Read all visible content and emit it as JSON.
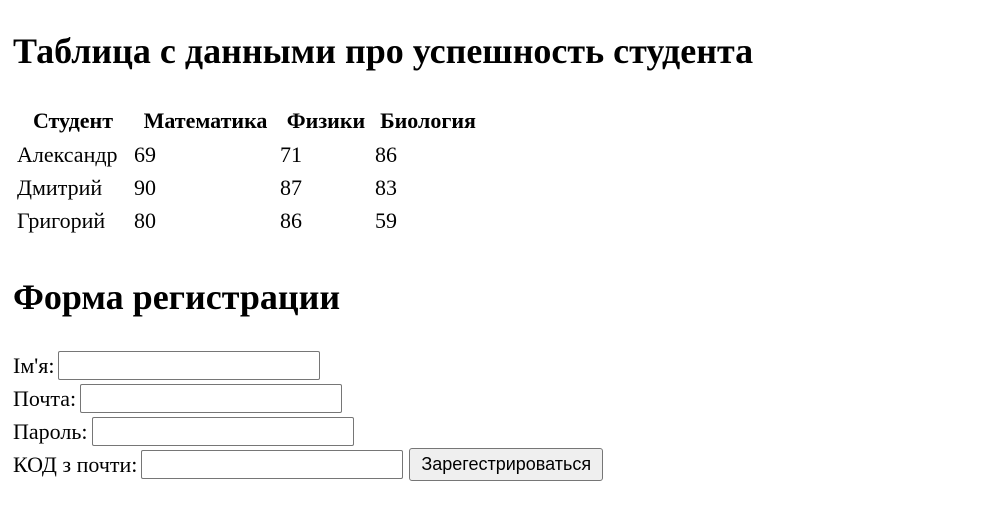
{
  "table_section": {
    "title": "Таблица с данными про успешность студента",
    "headers": [
      "Студент",
      "Математика",
      "Физики",
      "Биология"
    ],
    "rows": [
      [
        "Александр",
        "69",
        "71",
        "86"
      ],
      [
        "Дмитрий",
        "90",
        "87",
        "83"
      ],
      [
        "Григорий",
        "80",
        "86",
        "59"
      ]
    ]
  },
  "form_section": {
    "title": "Форма регистрации",
    "fields": [
      {
        "label": "Ім'я:",
        "value": "",
        "placeholder": ""
      },
      {
        "label": "Почта:",
        "value": "",
        "placeholder": ""
      },
      {
        "label": "Пароль:",
        "value": "",
        "placeholder": ""
      },
      {
        "label": "КОД з почти:",
        "value": "",
        "placeholder": ""
      }
    ],
    "submit_label": "Зарегестрироваться"
  }
}
